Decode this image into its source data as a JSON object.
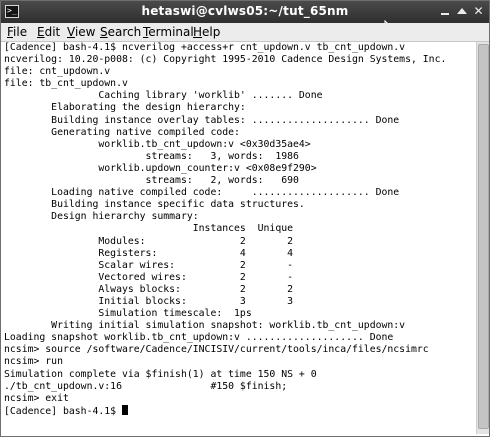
{
  "window": {
    "title": "hetaswi@cvlws05:~/tut_65nm",
    "app_icon_glyph": ">_",
    "controls": {
      "minimize_icon": "minimize-icon",
      "maximize_icon": "maximize-icon",
      "close_glyph": "✕"
    }
  },
  "menu": {
    "file": {
      "accel": "F",
      "rest": "ile"
    },
    "edit": {
      "accel": "E",
      "rest": "dit"
    },
    "view": {
      "accel": "V",
      "rest": "iew"
    },
    "search": {
      "accel": "S",
      "rest": "earch"
    },
    "terminal": {
      "accel": "T",
      "rest": "erminal"
    },
    "help": {
      "accel": "H",
      "rest": "elp"
    }
  },
  "terminal": {
    "lines": [
      "[Cadence] bash-4.1$ ncverilog +access+r cnt_updown.v tb_cnt_updown.v",
      "ncverilog: 10.20-p008: (c) Copyright 1995-2010 Cadence Design Systems, Inc.",
      "file: cnt_updown.v",
      "file: tb_cnt_updown.v",
      "                Caching library 'worklib' ....... Done",
      "        Elaborating the design hierarchy:",
      "        Building instance overlay tables: .................... Done",
      "        Generating native compiled code:",
      "                worklib.tb_cnt_updown:v <0x30d35ae4>",
      "                        streams:   3, words:  1986",
      "                worklib.updown_counter:v <0x08e9f290>",
      "                        streams:   2, words:   690",
      "        Loading native compiled code:     .................... Done",
      "        Building instance specific data structures.",
      "        Design hierarchy summary:",
      "                                Instances  Unique",
      "                Modules:                2       2",
      "                Registers:              4       4",
      "                Scalar wires:           2       -",
      "                Vectored wires:         2       -",
      "                Always blocks:          2       2",
      "                Initial blocks:         3       3",
      "                Simulation timescale:  1ps",
      "        Writing initial simulation snapshot: worklib.tb_cnt_updown:v",
      "Loading snapshot worklib.tb_cnt_updown:v .................... Done",
      "ncsim> source /software/Cadence/INCISIV/current/tools/inca/files/ncsimrc",
      "ncsim> run",
      "Simulation complete via $finish(1) at time 150 NS + 0",
      "./tb_cnt_updown.v:16               #150 $finish;",
      "ncsim> exit"
    ],
    "prompt": "[Cadence] bash-4.1$ "
  }
}
